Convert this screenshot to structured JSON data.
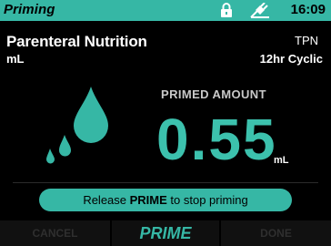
{
  "status_bar": {
    "title": "Priming",
    "time": "16:09",
    "lock_icon": "lock-icon",
    "ac_power_icon": "ac-power-plug-icon",
    "background_color": "#36b7a5"
  },
  "therapy": {
    "name": "Parenteral Nutrition",
    "unit": "mL",
    "code": "TPN",
    "mode": "12hr Cyclic"
  },
  "primed": {
    "label": "PRIMED AMOUNT",
    "value": "0.55",
    "unit": "mL",
    "value_color": "#3cc1ad"
  },
  "prompt": {
    "prefix": "Release ",
    "key": "PRIME",
    "suffix": " to stop priming"
  },
  "softkeys": {
    "left": "CANCEL",
    "middle": "PRIME",
    "right": "DONE"
  },
  "accent_color": "#36b7a5"
}
